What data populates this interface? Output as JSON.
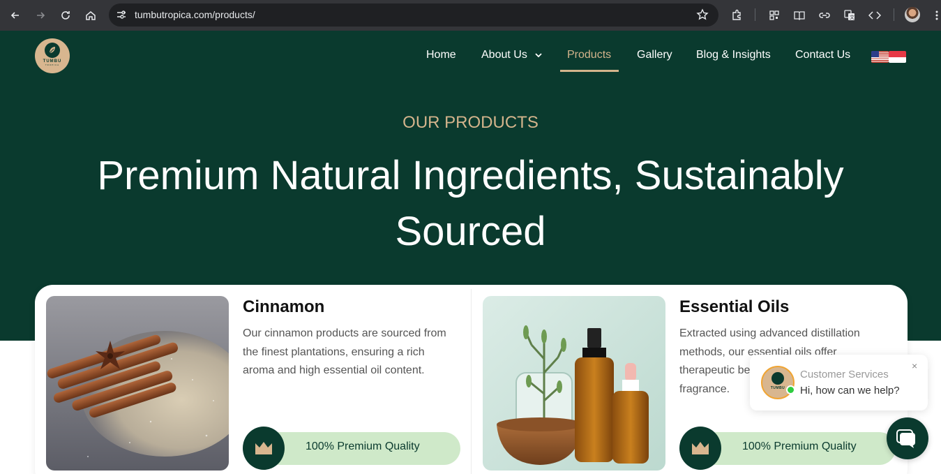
{
  "browser": {
    "url": "tumbutropica.com/products/",
    "icons": [
      "back-icon",
      "forward-icon",
      "reload-icon",
      "home-icon",
      "site-settings-icon",
      "bookmark-star-icon",
      "extensions-icon",
      "qr-code-icon",
      "reader-mode-icon",
      "link-icon",
      "translate-icon",
      "code-icon",
      "profile-avatar",
      "more-menu-icon"
    ]
  },
  "header": {
    "logo_text": "TUMBU",
    "logo_sub": "TROPICA",
    "nav": [
      "Home",
      "About Us",
      "Products",
      "Gallery",
      "Blog & Insights",
      "Contact Us"
    ],
    "active": "Products"
  },
  "hero": {
    "eyebrow": "OUR PRODUCTS",
    "headline": "Premium Natural Ingredients, Sustainably Sourced"
  },
  "products": [
    {
      "title": "Cinnamon",
      "description": "Our cinnamon products are sourced from the finest plantations, ensuring a rich aroma and high essential oil content.",
      "quality": "100% Premium Quality"
    },
    {
      "title": "Essential Oils",
      "description": "Extracted using advanced distillation methods, our essential oils offer therapeutic be",
      "description_tail": "fragrance.",
      "quality": "100% Premium Quality"
    }
  ],
  "chat": {
    "name": "Customer Services",
    "message": "Hi, how can we help?",
    "close": "×"
  },
  "colors": {
    "brand_dark": "#0a3a2e",
    "gold": "#d4b48c",
    "quality_pill": "#cfe9c9",
    "chrome": "#343539"
  }
}
